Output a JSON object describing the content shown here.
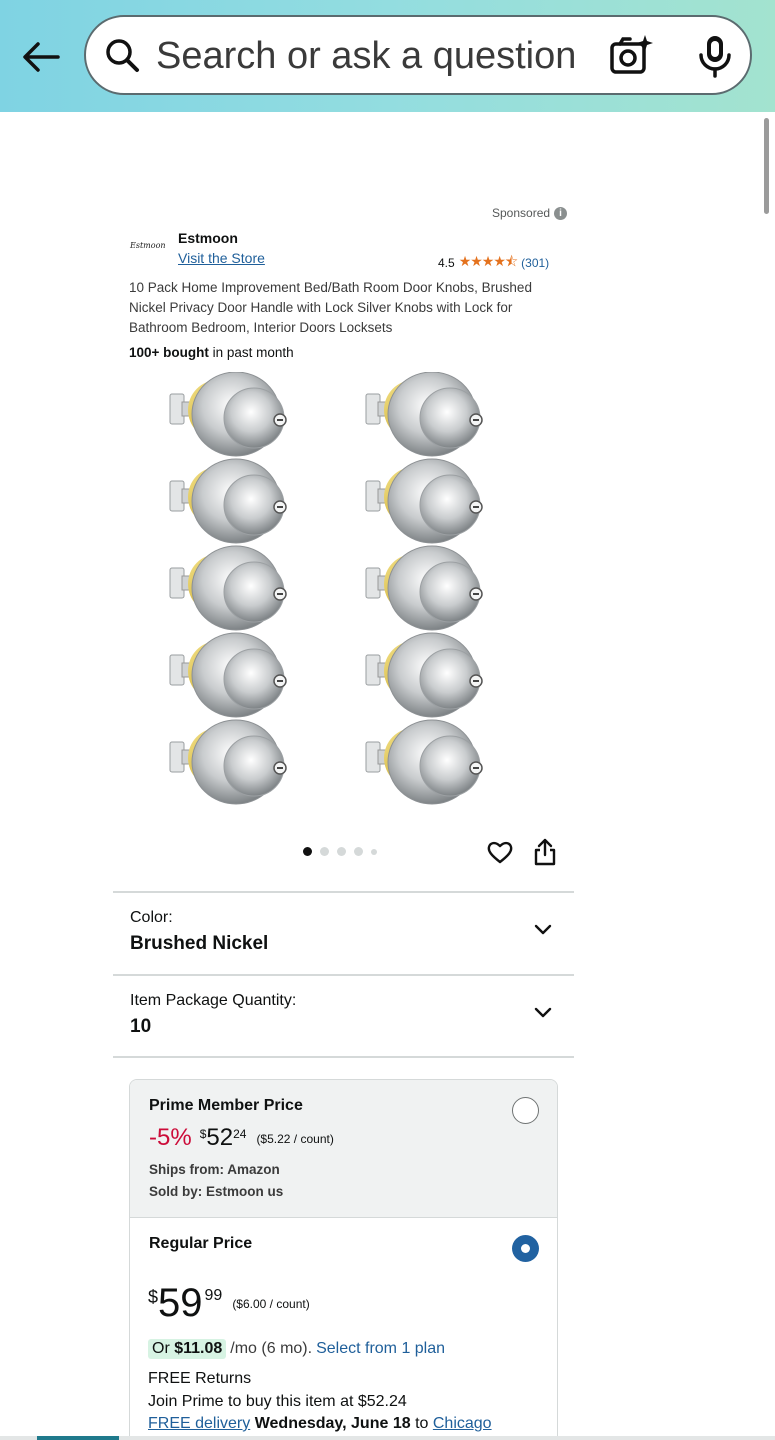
{
  "header": {
    "back_icon": "arrow-left-icon",
    "search_placeholder": "Search or ask a question",
    "camera_icon": "camera-sparkle-icon",
    "mic_icon": "microphone-icon"
  },
  "ad": {
    "sponsored_label": "Sponsored",
    "brand_logo_text": "Estmoon",
    "brand_name": "Estmoon",
    "visit_store": "Visit the Store",
    "rating_value": "4.5",
    "stars": "★★★★⯪",
    "review_count": "(301)",
    "title": "10 Pack Home Improvement Bed/Bath Room Door Knobs, Brushed Nickel Privacy Door Handle with Lock Silver Knobs with Lock for Bathroom Bedroom, Interior Doors Locksets",
    "bought_strong": "100+ bought",
    "bought_rest": " in past month"
  },
  "gallery": {
    "image_count": 5,
    "active_index": 0,
    "knob_rows": 5,
    "knob_columns": 2
  },
  "variants": {
    "color_label": "Color:",
    "color_value": "Brushed Nickel",
    "qty_label": "Item Package Quantity:",
    "qty_value": "10"
  },
  "pricing": {
    "prime": {
      "title": "Prime Member Price",
      "discount": "-5%",
      "currency": "$",
      "whole": "52",
      "fraction": "24",
      "per_unit": "($5.22 / count)",
      "ships_from": "Ships from: Amazon",
      "sold_by": "Sold by: Estmoon us",
      "selected": false
    },
    "regular": {
      "title": "Regular Price",
      "currency": "$",
      "whole": "59",
      "fraction": "99",
      "per_unit": "($6.00 / count)",
      "selected": true,
      "monthly_prefix": "Or ",
      "monthly_amount": "$11.08",
      "monthly_suffix": "/mo (6 mo).",
      "plan_link": "Select from 1 plan",
      "returns": "FREE Returns",
      "join_prime": "Join Prime to buy this item at $52.24",
      "free_delivery": "FREE delivery",
      "delivery_date": "Wednesday, June 18",
      "to": "to",
      "location": "Chicago"
    }
  }
}
